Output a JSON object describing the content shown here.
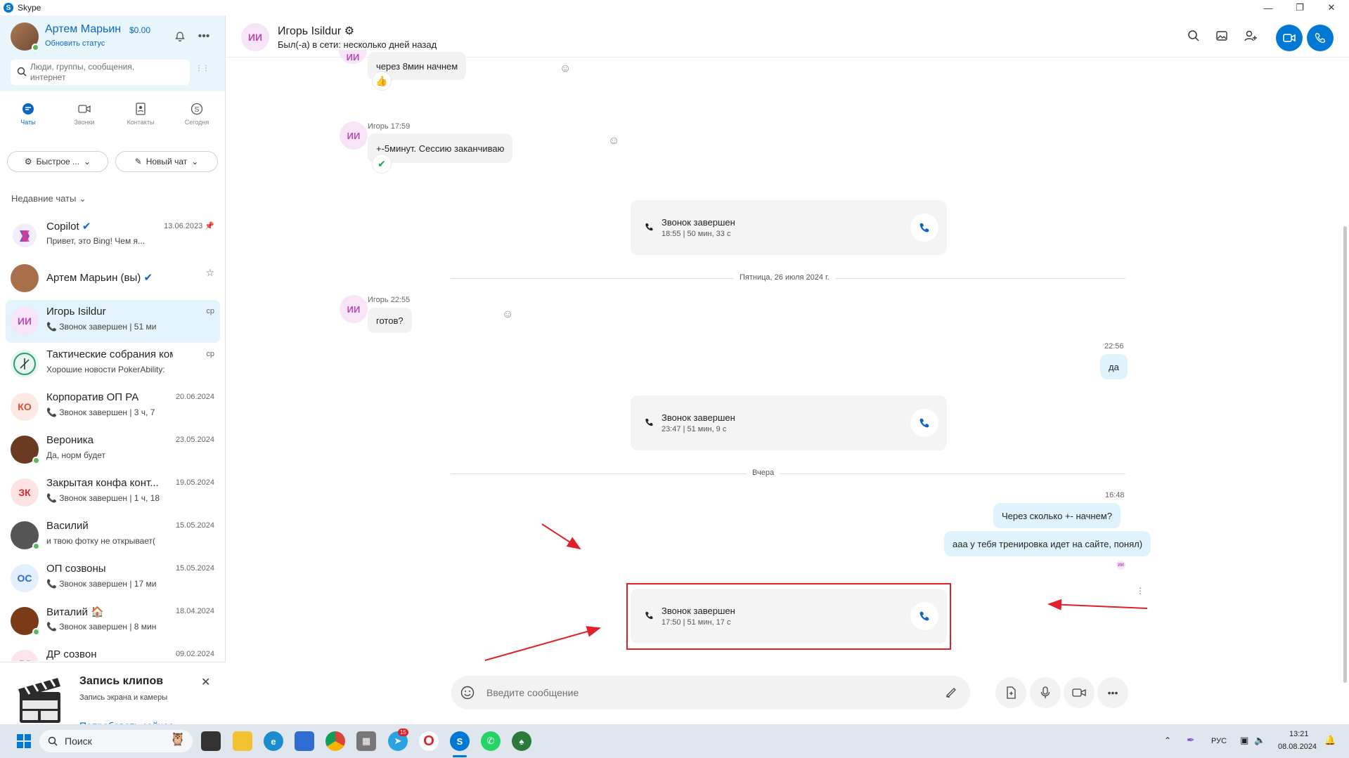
{
  "window": {
    "title": "Skype",
    "minimize": "—",
    "maximize": "❐",
    "close": "✕"
  },
  "profile": {
    "name": "Артем Марьин",
    "balance": "$0.00",
    "status_link": "Обновить статус"
  },
  "search": {
    "placeholder_line1": "Люди, группы, сообщения,",
    "placeholder_line2": "интернет"
  },
  "nav_tabs": [
    {
      "label": "Чаты",
      "icon": "chat-icon",
      "active": true
    },
    {
      "label": "Звонки",
      "icon": "video-icon",
      "active": false
    },
    {
      "label": "Контакты",
      "icon": "contacts-icon",
      "active": false
    },
    {
      "label": "Сегодня",
      "icon": "skype-icon",
      "active": false
    }
  ],
  "filters": {
    "quick": "Быстрое ...",
    "new_chat": "Новый чат"
  },
  "recent_label": "Недавние чаты",
  "chats": [
    {
      "initials": "",
      "name": "Copilot",
      "preview": "Привет, это Bing! Чем я...",
      "date": "13.06.2023",
      "avatar_bg": "#f3ecfd",
      "avatar_fg": "#7a4fd6",
      "verified": true
    },
    {
      "initials": "",
      "name": "Артем Марьин (вы)",
      "preview": "",
      "date": "",
      "avatar_bg": "#a8704a",
      "avatar_fg": "#fff",
      "verified": true
    },
    {
      "initials": "ИИ",
      "name": "Игорь Isildur",
      "preview": "📞 Звонок завершен | 51 ми",
      "date": "ср",
      "avatar_bg": "#f7e4f7",
      "avatar_fg": "#b04fb0",
      "verified": false
    },
    {
      "initials": "",
      "name": "Тактические собрания ком...",
      "preview": "Хорошие новости PokerAbility:",
      "date": "ср",
      "avatar_bg": "#e7f6f0",
      "avatar_fg": "#2a9d6a",
      "verified": false
    },
    {
      "initials": "КО",
      "name": "Корпоратив ОП РА",
      "preview": "📞 Звонок завершен | 3 ч, 7",
      "date": "20.06.2024",
      "avatar_bg": "#fde9e3",
      "avatar_fg": "#d1502d",
      "verified": false
    },
    {
      "initials": "",
      "name": "Вероника",
      "preview": "Да, норм будет",
      "date": "23.05.2024",
      "avatar_bg": "#6b3a22",
      "avatar_fg": "#fff",
      "verified": false
    },
    {
      "initials": "ЗК",
      "name": "Закрытая конфа конт...",
      "preview": "📞 Звонок завершен | 1 ч, 18",
      "date": "19.05.2024",
      "avatar_bg": "#fde3e3",
      "avatar_fg": "#d12d2d",
      "verified": false
    },
    {
      "initials": "",
      "name": "Василий",
      "preview": "и твою фотку не открывает(",
      "date": "15.05.2024",
      "avatar_bg": "#555",
      "avatar_fg": "#fff",
      "verified": false
    },
    {
      "initials": "ОС",
      "name": "ОП созвоны",
      "preview": "📞 Звонок завершен | 17 ми",
      "date": "15.05.2024",
      "avatar_bg": "#e3effd",
      "avatar_fg": "#2d6ad1",
      "verified": false
    },
    {
      "initials": "",
      "name": "Виталий 🏠",
      "preview": "📞 Звонок завершен | 8 мин",
      "date": "18.04.2024",
      "avatar_bg": "#7a3b16",
      "avatar_fg": "#fff",
      "verified": false
    },
    {
      "initials": "ДС",
      "name": "ДР созвон",
      "preview": "",
      "date": "09.02.2024",
      "avatar_bg": "#fde3ee",
      "avatar_fg": "#d12d7a",
      "verified": false
    }
  ],
  "promo": {
    "title": "Запись клипов",
    "subtitle": "Запись экрана и камеры",
    "link": "Попробовать сейчас"
  },
  "conversation": {
    "initials": "ИИ",
    "name": "Игорь Isildur",
    "status": "Был(-а) в сети: несколько дней назад",
    "messages": {
      "m1_text": "через 8мин начнем",
      "m1_reaction": "👍",
      "m2_meta": "Игорь 17:59",
      "m2_text": "+-5минут. Сессию заканчиваю",
      "m2_reaction": "✔",
      "call1_title": "Звонок завершен",
      "call1_sub": "18:55 | 50 мин, 33 с",
      "date1": "Пятница, 26 июля 2024 г.",
      "m3_meta": "Игорь 22:55",
      "m3_text": "готов?",
      "out1_time": "22:56",
      "out1_text": "да",
      "call2_title": "Звонок завершен",
      "call2_sub": "23:47 | 51 мин, 9 с",
      "date2": "Вчера",
      "out2_time": "16:48",
      "out2_text1": "Через сколько +- начнем?",
      "out2_text2": "ааа у тебя тренировка идет на сайте, понял)",
      "seen_initials": "ИИ",
      "call3_title": "Звонок завершен",
      "call3_sub": "17:50 | 51 мин, 17 с"
    }
  },
  "composer": {
    "placeholder": "Введите сообщение"
  },
  "taskbar": {
    "search_placeholder": "Поиск",
    "lang": "РУС",
    "time": "13:21",
    "date": "08.08.2024",
    "telegram_badge": "15"
  },
  "colors": {
    "accent": "#0078d4",
    "annotation": "#e0212b"
  }
}
